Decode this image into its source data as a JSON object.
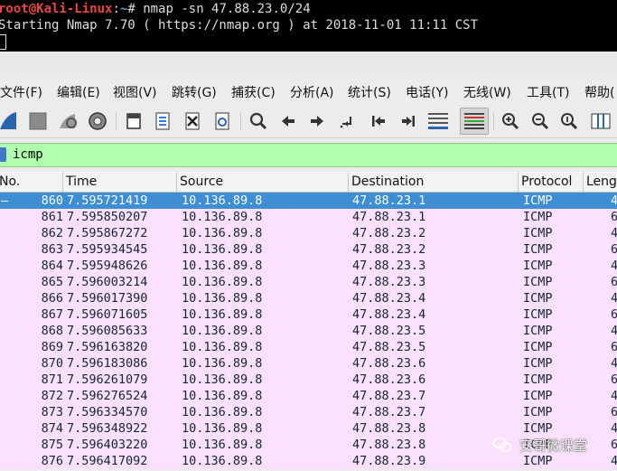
{
  "terminal": {
    "user_host": "root@Kali-Linux",
    "path": "~",
    "prompt_symbol": "#",
    "command": "nmap -sn 47.88.23.0/24",
    "output_line": "Starting Nmap 7.70 ( https://nmap.org ) at 2018-11-01 11:11 CST"
  },
  "menu": [
    {
      "label": "文件(F)"
    },
    {
      "label": "编辑(E)"
    },
    {
      "label": "视图(V)"
    },
    {
      "label": "跳转(G)"
    },
    {
      "label": "捕获(C)"
    },
    {
      "label": "分析(A)"
    },
    {
      "label": "统计(S)"
    },
    {
      "label": "电话(Y)"
    },
    {
      "label": "无线(W)"
    },
    {
      "label": "工具(T)"
    },
    {
      "label": "帮助("
    }
  ],
  "toolbar_icons": [
    "shark-fin-icon",
    "stop-icon",
    "restart-icon",
    "gear-icon",
    "open-file-icon",
    "save-file-icon",
    "close-file-icon",
    "reload-icon",
    "search-icon",
    "arrow-left-icon",
    "arrow-right-icon",
    "go-to-packet-icon",
    "first-packet-icon",
    "last-packet-icon",
    "autoscroll-icon",
    "colorize-icon",
    "zoom-in-icon",
    "zoom-out-icon",
    "zoom-normal-icon",
    "resize-columns-icon"
  ],
  "filter": {
    "value": "icmp",
    "bg_color": "#afffaf"
  },
  "columns": {
    "no": "No.",
    "time": "Time",
    "source": "Source",
    "destination": "Destination",
    "protocol": "Protocol",
    "length": "Lengt"
  },
  "colors": {
    "row_bg": "#fce0ff",
    "selected_bg": "#3d8ed3"
  },
  "packets": [
    {
      "no": "860",
      "time": "7.595721419",
      "source": "10.136.89.8",
      "destination": "47.88.23.1",
      "protocol": "ICMP",
      "length": "4",
      "selected": true
    },
    {
      "no": "861",
      "time": "7.595850207",
      "source": "10.136.89.8",
      "destination": "47.88.23.1",
      "protocol": "ICMP",
      "length": "6"
    },
    {
      "no": "862",
      "time": "7.595867272",
      "source": "10.136.89.8",
      "destination": "47.88.23.2",
      "protocol": "ICMP",
      "length": "4"
    },
    {
      "no": "863",
      "time": "7.595934545",
      "source": "10.136.89.8",
      "destination": "47.88.23.2",
      "protocol": "ICMP",
      "length": "6"
    },
    {
      "no": "864",
      "time": "7.595948626",
      "source": "10.136.89.8",
      "destination": "47.88.23.3",
      "protocol": "ICMP",
      "length": "4"
    },
    {
      "no": "865",
      "time": "7.596003214",
      "source": "10.136.89.8",
      "destination": "47.88.23.3",
      "protocol": "ICMP",
      "length": "6"
    },
    {
      "no": "866",
      "time": "7.596017390",
      "source": "10.136.89.8",
      "destination": "47.88.23.4",
      "protocol": "ICMP",
      "length": "4"
    },
    {
      "no": "867",
      "time": "7.596071605",
      "source": "10.136.89.8",
      "destination": "47.88.23.4",
      "protocol": "ICMP",
      "length": "6"
    },
    {
      "no": "868",
      "time": "7.596085633",
      "source": "10.136.89.8",
      "destination": "47.88.23.5",
      "protocol": "ICMP",
      "length": "4"
    },
    {
      "no": "869",
      "time": "7.596163820",
      "source": "10.136.89.8",
      "destination": "47.88.23.5",
      "protocol": "ICMP",
      "length": "6"
    },
    {
      "no": "870",
      "time": "7.596183086",
      "source": "10.136.89.8",
      "destination": "47.88.23.6",
      "protocol": "ICMP",
      "length": "4"
    },
    {
      "no": "871",
      "time": "7.596261079",
      "source": "10.136.89.8",
      "destination": "47.88.23.6",
      "protocol": "ICMP",
      "length": "6"
    },
    {
      "no": "872",
      "time": "7.596276524",
      "source": "10.136.89.8",
      "destination": "47.88.23.7",
      "protocol": "ICMP",
      "length": "4"
    },
    {
      "no": "873",
      "time": "7.596334570",
      "source": "10.136.89.8",
      "destination": "47.88.23.7",
      "protocol": "ICMP",
      "length": "6"
    },
    {
      "no": "874",
      "time": "7.596348922",
      "source": "10.136.89.8",
      "destination": "47.88.23.8",
      "protocol": "ICMP",
      "length": "4"
    },
    {
      "no": "875",
      "time": "7.596403220",
      "source": "10.136.89.8",
      "destination": "47.88.23.8",
      "protocol": "ICMP",
      "length": "6"
    },
    {
      "no": "876",
      "time": "7.596417092",
      "source": "10.136.89.8",
      "destination": "47.88.23.9",
      "protocol": "ICMP",
      "length": "4"
    }
  ],
  "watermark": {
    "text": "安哥微课堂"
  }
}
